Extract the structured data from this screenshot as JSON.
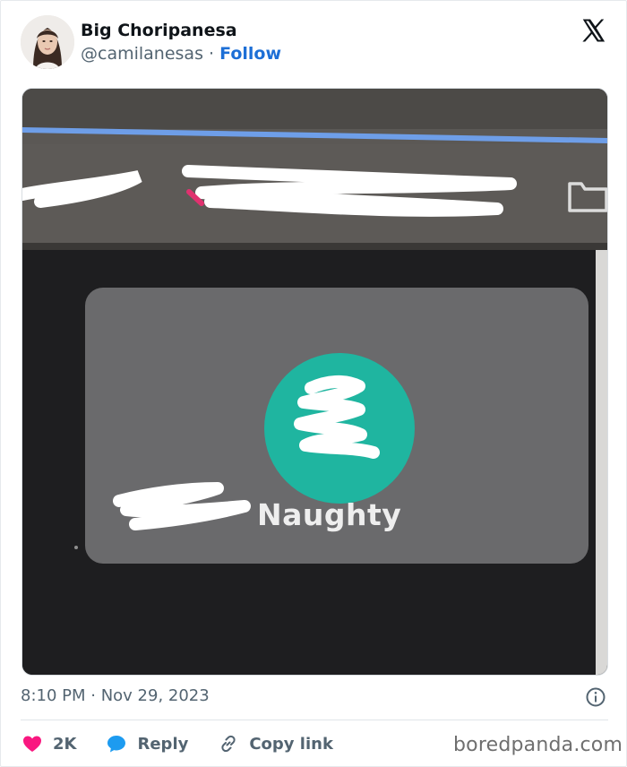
{
  "tweet": {
    "display_name": "Big Choripanesa",
    "handle": "@camilanesas",
    "separator": "·",
    "follow_label": "Follow",
    "timestamp": "8:10 PM · Nov 29, 2023"
  },
  "media": {
    "caption_in_image": "Naughty"
  },
  "actions": {
    "like_count": "2K",
    "reply_label": "Reply",
    "copy_link_label": "Copy link"
  },
  "watermark": "boredpanda.com",
  "colors": {
    "follow": "#1d6fd6",
    "like_heart": "#f91880",
    "reply_bubble": "#1d9bf0",
    "secondary_text": "#536471",
    "teal_circle": "#1fb5a0"
  },
  "icons": {
    "brand": "x-logo-icon",
    "info": "info-icon",
    "like": "heart-icon",
    "reply": "speech-bubble-icon",
    "copy_link": "link-icon"
  }
}
